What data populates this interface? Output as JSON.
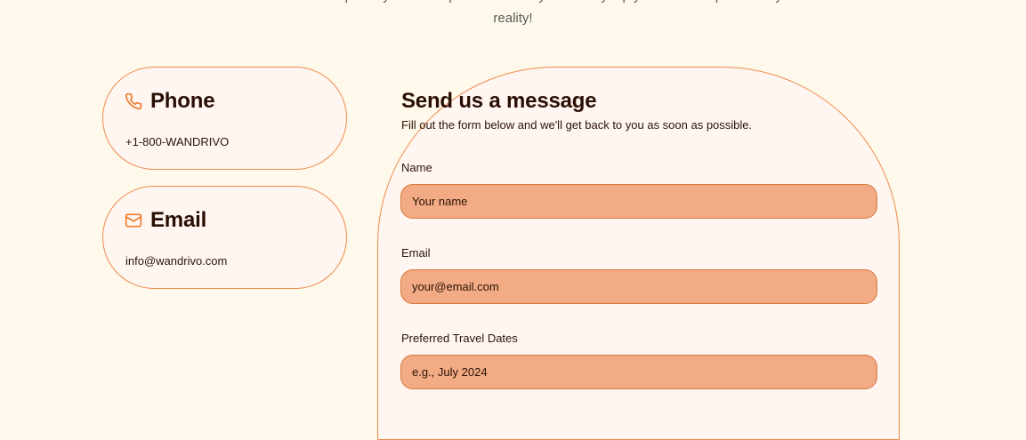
{
  "hero": {
    "line1": "We're here to help turn your travel plans into reality and every trip you dream of possible by",
    "line2": "reality!"
  },
  "contact_cards": {
    "phone": {
      "icon": "phone-icon",
      "title": "Phone",
      "value": "+1-800-WANDRIVO"
    },
    "email": {
      "icon": "mail-icon",
      "title": "Email",
      "value": "info@wandrivo.com"
    }
  },
  "form": {
    "title": "Send us a message",
    "subtitle": "Fill out the form below and we'll get back to you as soon as possible.",
    "fields": {
      "name": {
        "label": "Name",
        "placeholder": "Your name",
        "value": ""
      },
      "email": {
        "label": "Email",
        "placeholder": "your@email.com",
        "value": ""
      },
      "dates": {
        "label": "Preferred Travel Dates",
        "placeholder": "e.g., July 2024",
        "value": ""
      }
    }
  },
  "colors": {
    "page_background": "#fef9ea",
    "card_background": "#fff6f2",
    "accent_border": "#f08a4b",
    "input_fill": "#f2ab84",
    "icon_color": "#f07a2a"
  }
}
